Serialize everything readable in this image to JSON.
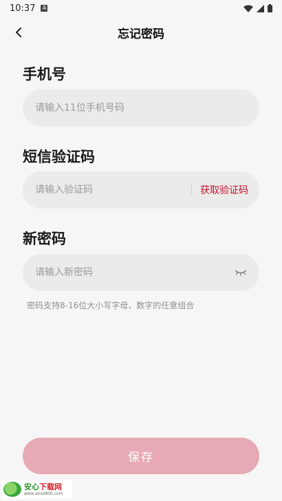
{
  "status_bar": {
    "time": "10:37",
    "indicator": "A"
  },
  "header": {
    "title": "忘记密码",
    "back_icon": "back-arrow"
  },
  "phone": {
    "label": "手机号",
    "placeholder": "请输入11位手机号码"
  },
  "sms": {
    "label": "短信验证码",
    "placeholder": "请输入验证码",
    "get_code_label": "获取验证码"
  },
  "new_password": {
    "label": "新密码",
    "placeholder": "请输入新密码",
    "toggle_icon": "eye-closed-icon",
    "hint": "密码支持8-16位大小写字母、数字的任意组合"
  },
  "save_label": "保存",
  "watermark": {
    "name_green": "安心",
    "name_red": "下载网",
    "url": "www.anxz800.com"
  },
  "colors": {
    "accent_red": "#c8102e",
    "save_button_disabled": "#e7a9b5",
    "field_bg": "#ebebeb",
    "page_bg": "#f6f6f6"
  }
}
